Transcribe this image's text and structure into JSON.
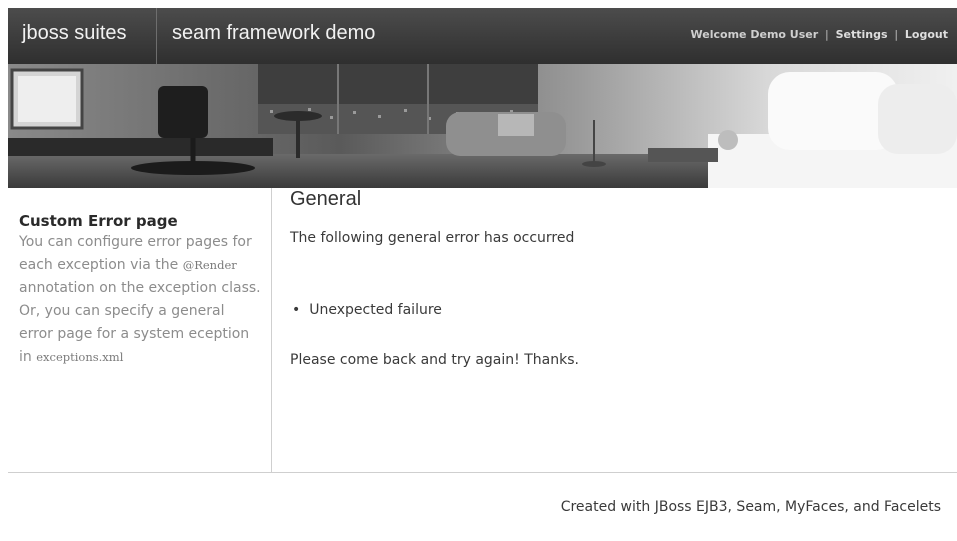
{
  "header": {
    "brand": "jboss suites",
    "app_title": "seam framework demo",
    "welcome": "Welcome Demo User",
    "settings_link": "Settings",
    "logout_link": "Logout",
    "separator": "|"
  },
  "banner": {
    "description_icon": "hotel-room-photo"
  },
  "sidebar": {
    "title": "Custom Error page",
    "text_part1": "You can configure error pages for each exception via the ",
    "code1": "@Render",
    "text_part2": " annotation on the exception class. Or, you can specify a general error page for a system eception in ",
    "code2": "exceptions.xml"
  },
  "main": {
    "heading": "General",
    "intro": "The following general error has occurred",
    "messages": [
      "Unexpected failure"
    ],
    "closing": "Please come back and try again! Thanks."
  },
  "footer": {
    "text": "Created with JBoss EJB3, Seam, MyFaces, and Facelets"
  },
  "colors": {
    "header_bg": "#3d3d3d",
    "header_text": "#f2f2f2",
    "sidebar_text": "#8c8c8c",
    "body_text": "#3a3a3a",
    "rule": "#cfcfcf"
  }
}
